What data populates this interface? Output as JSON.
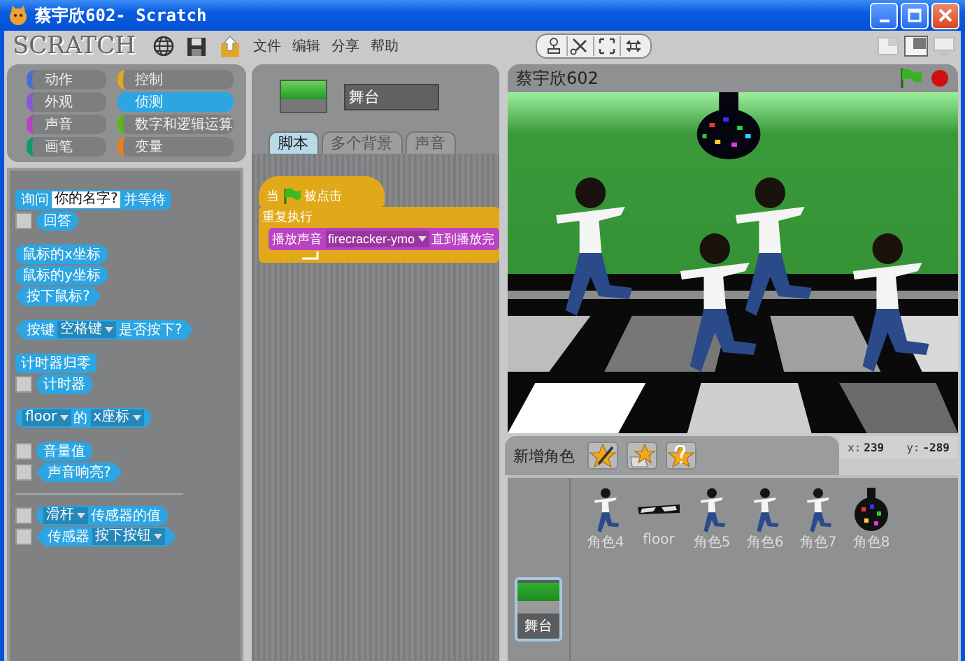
{
  "window": {
    "title": "蔡宇欣602- Scratch"
  },
  "menubar": {
    "logo": "SCRATCH",
    "menus": [
      "文件",
      "编辑",
      "分享",
      "帮助"
    ]
  },
  "categories": [
    {
      "label": "动作",
      "color": "#4a6cd4",
      "selected": false
    },
    {
      "label": "控制",
      "color": "#e1a91a",
      "selected": false
    },
    {
      "label": "外观",
      "color": "#8a55d7",
      "selected": false
    },
    {
      "label": "侦测",
      "color": "#2ca5e2",
      "selected": true
    },
    {
      "label": "声音",
      "color": "#bb42c3",
      "selected": false
    },
    {
      "label": "数字和逻辑运算",
      "color": "#5cb712",
      "selected": false
    },
    {
      "label": "画笔",
      "color": "#0e9a6c",
      "selected": false
    },
    {
      "label": "变量",
      "color": "#ee7d16",
      "selected": false
    }
  ],
  "palette": [
    {
      "kind": "group",
      "blocks": [
        {
          "kind": "command",
          "parts": [
            {
              "kind": "text",
              "text": "询问"
            },
            {
              "kind": "input",
              "text": "你的名字?"
            },
            {
              "kind": "text",
              "text": "并等待"
            }
          ]
        },
        {
          "kind": "reporter",
          "checked": false,
          "parts": [
            {
              "kind": "text",
              "text": "回答"
            }
          ]
        }
      ]
    },
    {
      "kind": "group",
      "blocks": [
        {
          "kind": "reporter",
          "parts": [
            {
              "kind": "text",
              "text": "鼠标的x坐标"
            }
          ]
        },
        {
          "kind": "reporter",
          "parts": [
            {
              "kind": "text",
              "text": "鼠标的y坐标"
            }
          ]
        },
        {
          "kind": "boolean",
          "parts": [
            {
              "kind": "text",
              "text": "按下鼠标?"
            }
          ]
        }
      ]
    },
    {
      "kind": "group",
      "blocks": [
        {
          "kind": "boolean",
          "parts": [
            {
              "kind": "text",
              "text": "按键"
            },
            {
              "kind": "dropdown",
              "text": "空格键"
            },
            {
              "kind": "text",
              "text": "是否按下?"
            }
          ]
        }
      ]
    },
    {
      "kind": "group",
      "blocks": [
        {
          "kind": "command",
          "parts": [
            {
              "kind": "text",
              "text": "计时器归零"
            }
          ]
        },
        {
          "kind": "reporter",
          "checked": false,
          "parts": [
            {
              "kind": "text",
              "text": "计时器"
            }
          ]
        }
      ]
    },
    {
      "kind": "group",
      "blocks": [
        {
          "kind": "reporter",
          "parts": [
            {
              "kind": "dropdown",
              "text": "floor"
            },
            {
              "kind": "text",
              "text": "的"
            },
            {
              "kind": "dropdown",
              "text": "x座标"
            }
          ]
        }
      ]
    },
    {
      "kind": "group",
      "blocks": [
        {
          "kind": "reporter",
          "checked": false,
          "parts": [
            {
              "kind": "text",
              "text": "音量值"
            }
          ]
        },
        {
          "kind": "boolean",
          "checked": false,
          "parts": [
            {
              "kind": "text",
              "text": "声音响亮?"
            }
          ]
        }
      ]
    },
    {
      "kind": "divider"
    },
    {
      "kind": "group",
      "blocks": [
        {
          "kind": "reporter",
          "checked": false,
          "parts": [
            {
              "kind": "dropdown",
              "text": "滑杆"
            },
            {
              "kind": "text",
              "text": "传感器的值"
            }
          ]
        },
        {
          "kind": "boolean",
          "checked": false,
          "parts": [
            {
              "kind": "text",
              "text": "传感器"
            },
            {
              "kind": "dropdown",
              "text": "按下按钮"
            }
          ]
        }
      ]
    }
  ],
  "sprite_info": {
    "name": "舞台"
  },
  "tabs": [
    {
      "label": "脚本",
      "selected": true
    },
    {
      "label": "多个背景",
      "selected": false
    },
    {
      "label": "声音",
      "selected": false
    }
  ],
  "script": [
    {
      "kind": "hat",
      "color": "#e1a91a",
      "parts": [
        {
          "kind": "text",
          "text": "当"
        },
        {
          "kind": "flag"
        },
        {
          "kind": "text",
          "text": "被点击"
        }
      ]
    },
    {
      "kind": "c",
      "color": "#e1a91a",
      "parts": [
        {
          "kind": "text",
          "text": "重复执行"
        }
      ],
      "children": [
        {
          "kind": "command",
          "color": "#bb42c3",
          "parts": [
            {
              "kind": "text",
              "text": "播放声音"
            },
            {
              "kind": "dropdown",
              "text": "firecracker-ymo"
            },
            {
              "kind": "text",
              "text": "直到播放完"
            }
          ]
        }
      ]
    }
  ],
  "stage": {
    "title": "蔡宇欣602"
  },
  "sprite_bar": {
    "label": "新增角色",
    "mouse_x": {
      "label": "x:",
      "value": "239"
    },
    "mouse_y": {
      "label": "y:",
      "value": "-289"
    }
  },
  "stage_thumb": {
    "name": "舞台",
    "selected": true
  },
  "sprites": [
    {
      "name": "角色4",
      "kind": "dancer",
      "selected": false
    },
    {
      "name": "floor",
      "kind": "floor",
      "selected": false
    },
    {
      "name": "角色5",
      "kind": "dancer",
      "selected": false
    },
    {
      "name": "角色6",
      "kind": "dancer",
      "selected": false
    },
    {
      "name": "角色7",
      "kind": "dancer",
      "selected": false
    },
    {
      "name": "角色8",
      "kind": "disco",
      "selected": false
    }
  ]
}
